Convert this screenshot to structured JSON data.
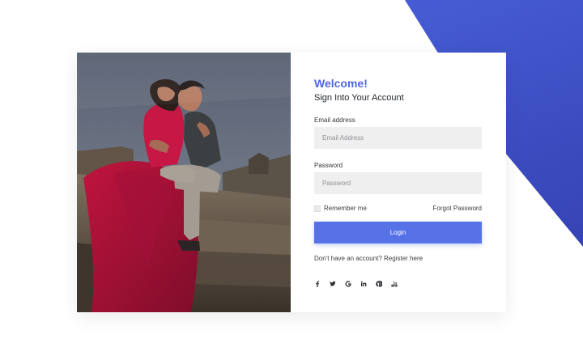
{
  "page": {
    "welcome_title": "Welcome!",
    "subtitle": "Sign Into Your Account"
  },
  "form": {
    "email_label": "Email address",
    "email_placeholder": "Email Address",
    "password_label": "Password",
    "password_placeholder": "Password",
    "remember_label": "Remember me",
    "forgot_label": "Forgot Password",
    "login_label": "Login",
    "register_text": "Don't have an account? Register here"
  },
  "social": [
    "facebook-icon",
    "twitter-icon",
    "google-icon",
    "linkedin-icon",
    "pinterest-icon",
    "youtube-icon"
  ],
  "colors": {
    "accent": "#4f67e3",
    "button": "#5672e6",
    "bg_shape_start": "#4f67e3",
    "bg_shape_end": "#2f3aa8"
  }
}
